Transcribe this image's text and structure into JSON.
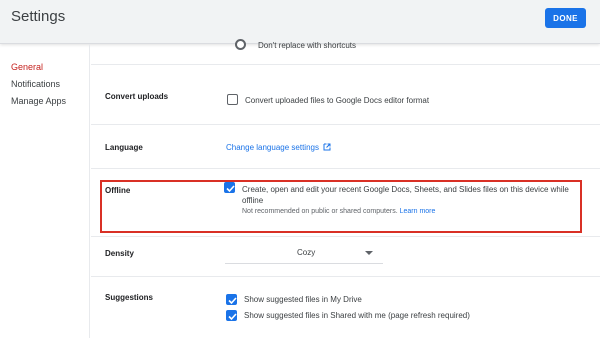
{
  "header": {
    "title": "Settings",
    "done_label": "DONE",
    "accent": "#1a73e8"
  },
  "sidebar": {
    "items": [
      {
        "label": "General",
        "active": true
      },
      {
        "label": "Notifications",
        "active": false
      },
      {
        "label": "Manage Apps",
        "active": false
      }
    ],
    "active_color": "#c5221f"
  },
  "settings": {
    "shortcuts": {
      "option_label": "Don't replace with shortcuts",
      "selected": false
    },
    "convert_uploads": {
      "label": "Convert uploads",
      "option_label": "Convert uploaded files to Google Docs editor format",
      "checked": false
    },
    "language": {
      "label": "Language",
      "link_text": "Change language settings",
      "link_icon": "open-in-new-icon"
    },
    "offline": {
      "label": "Offline",
      "option_line1": "Create, open and edit your recent Google Docs, Sheets, and Slides files on this device while",
      "option_line2": "offline",
      "note": "Not recommended on public or shared computers.",
      "learn_more": "Learn more",
      "checked": true,
      "highlight_color": "#d93025"
    },
    "density": {
      "label": "Density",
      "selected_value": "Cozy"
    },
    "suggestions": {
      "label": "Suggestions",
      "option1": "Show suggested files in My Drive",
      "option1_checked": true,
      "option2": "Show suggested files in Shared with me (page refresh required)",
      "option2_checked": true
    }
  }
}
